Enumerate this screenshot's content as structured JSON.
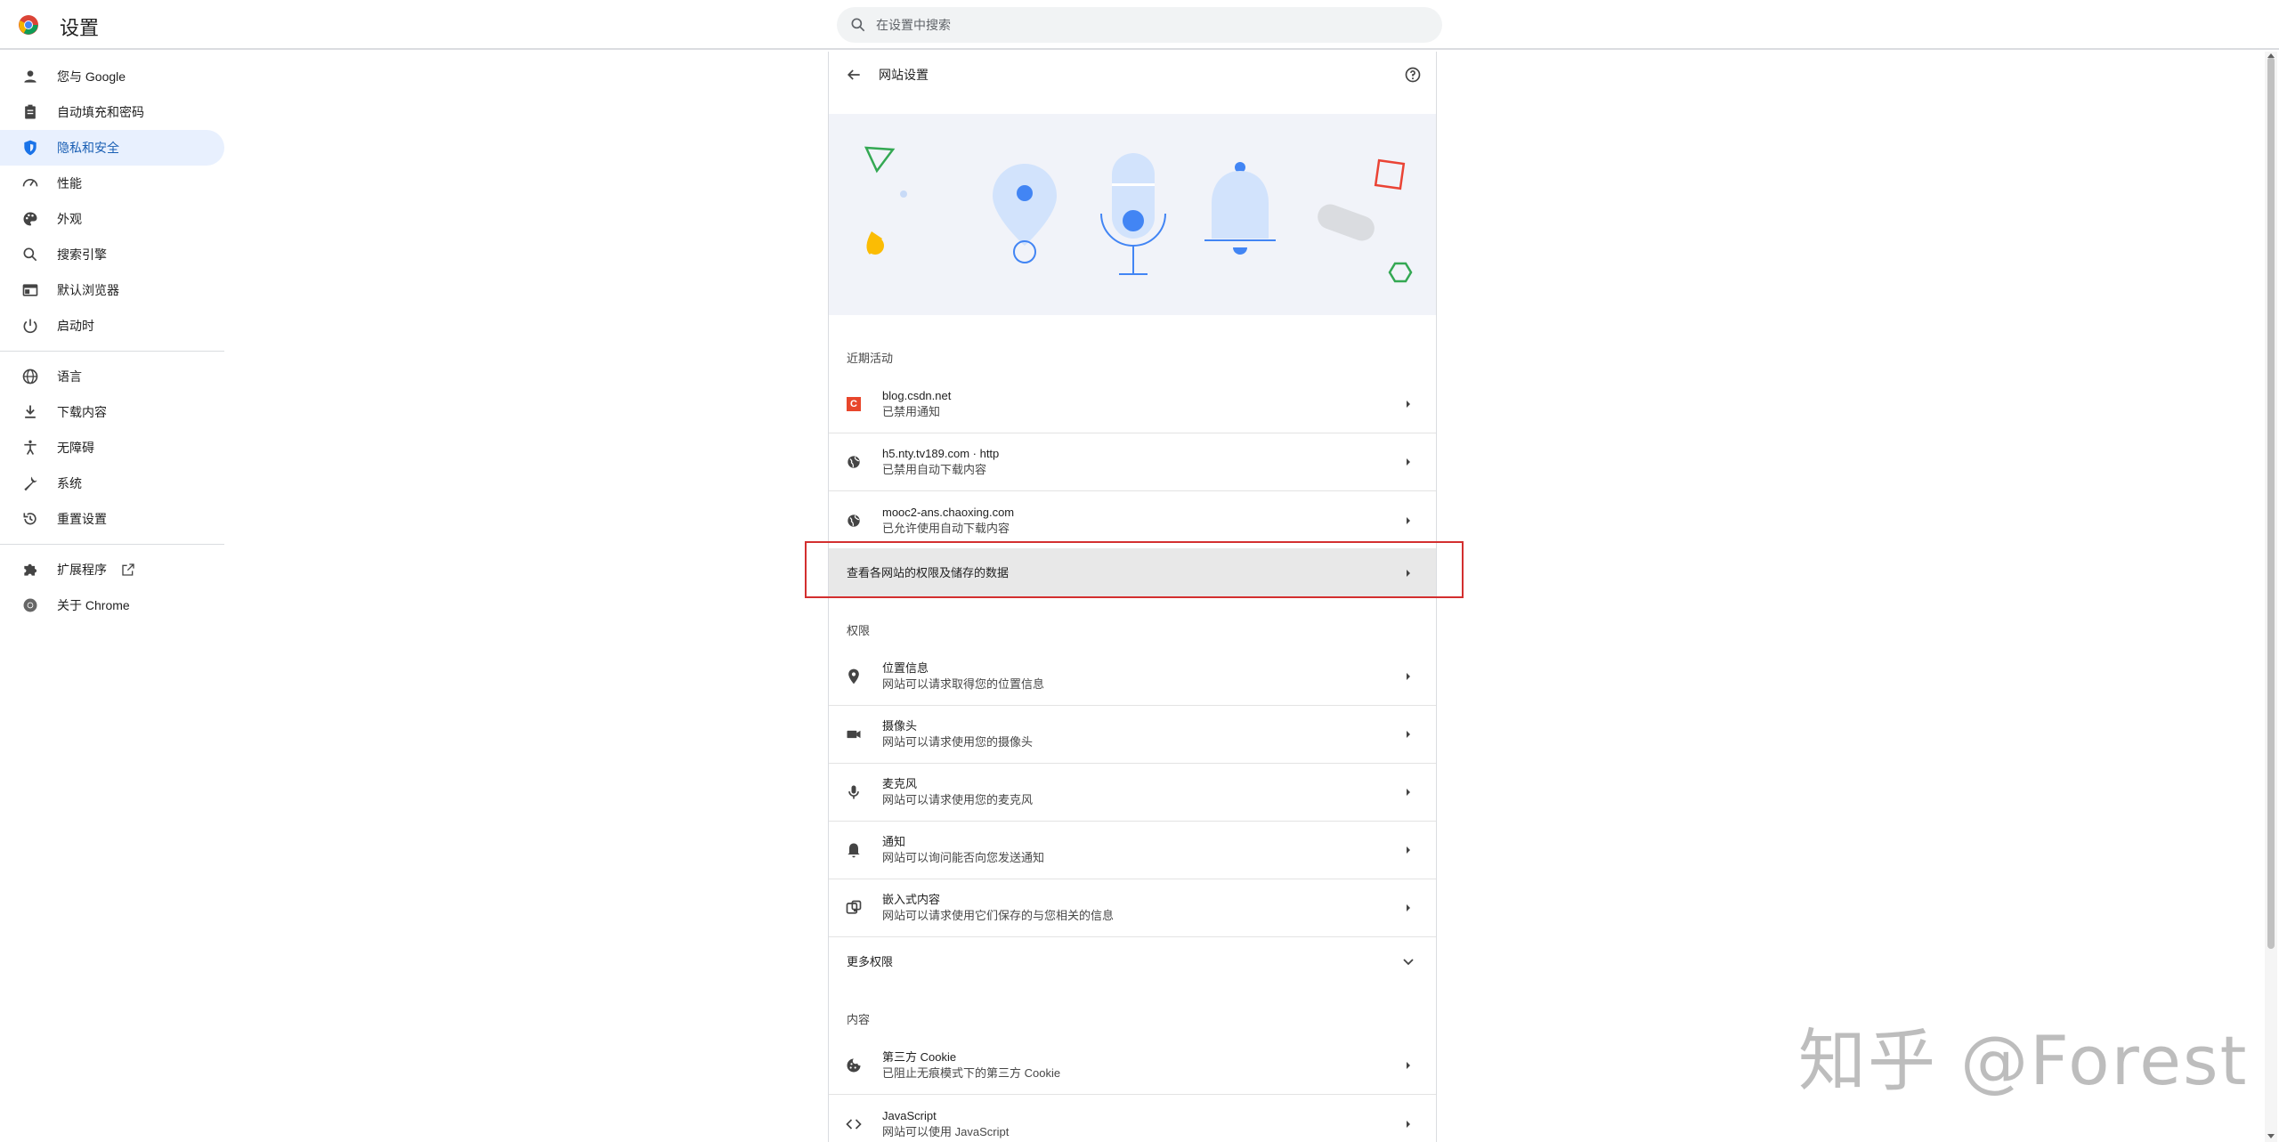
{
  "header": {
    "title": "设置",
    "search_placeholder": "在设置中搜索"
  },
  "sidebar": {
    "groups": [
      [
        {
          "label": "您与 Google",
          "icon": "person-icon"
        },
        {
          "label": "自动填充和密码",
          "icon": "clipboard-icon"
        },
        {
          "label": "隐私和安全",
          "icon": "shield-icon",
          "active": true
        },
        {
          "label": "性能",
          "icon": "gauge-icon"
        },
        {
          "label": "外观",
          "icon": "palette-icon"
        },
        {
          "label": "搜索引擎",
          "icon": "search-icon"
        },
        {
          "label": "默认浏览器",
          "icon": "browser-icon"
        },
        {
          "label": "启动时",
          "icon": "power-icon"
        }
      ],
      [
        {
          "label": "语言",
          "icon": "globe-icon"
        },
        {
          "label": "下载内容",
          "icon": "download-icon"
        },
        {
          "label": "无障碍",
          "icon": "accessibility-icon"
        },
        {
          "label": "系统",
          "icon": "wrench-icon"
        },
        {
          "label": "重置设置",
          "icon": "history-icon"
        }
      ],
      [
        {
          "label": "扩展程序",
          "icon": "puzzle-icon"
        },
        {
          "label": "关于 Chrome",
          "icon": "chrome-icon"
        }
      ]
    ]
  },
  "main": {
    "title": "网站设置",
    "recent_label": "近期活动",
    "recent": [
      {
        "site": "blog.csdn.net",
        "status": "已禁用通知",
        "icon": "csdn-icon"
      },
      {
        "site": "h5.nty.tv189.com · http",
        "status": "已禁用自动下载内容",
        "icon": "globe-icon"
      },
      {
        "site": "mooc2-ans.chaoxing.com",
        "status": "已允许使用自动下载内容",
        "icon": "globe-icon"
      }
    ],
    "view_all_label": "查看各网站的权限及储存的数据",
    "permissions_label": "权限",
    "permissions": [
      {
        "title": "位置信息",
        "desc": "网站可以请求取得您的位置信息",
        "icon": "location-icon"
      },
      {
        "title": "摄像头",
        "desc": "网站可以请求使用您的摄像头",
        "icon": "camera-icon"
      },
      {
        "title": "麦克风",
        "desc": "网站可以请求使用您的麦克风",
        "icon": "mic-icon"
      },
      {
        "title": "通知",
        "desc": "网站可以询问能否向您发送通知",
        "icon": "bell-icon"
      },
      {
        "title": "嵌入式内容",
        "desc": "网站可以请求使用它们保存的与您相关的信息",
        "icon": "embed-icon"
      }
    ],
    "more_permissions_label": "更多权限",
    "content_label": "内容",
    "content": [
      {
        "title": "第三方 Cookie",
        "desc": "已阻止无痕模式下的第三方 Cookie",
        "icon": "cookie-icon"
      },
      {
        "title": "JavaScript",
        "desc": "网站可以使用 JavaScript",
        "icon": "code-icon"
      }
    ]
  },
  "watermark": "知乎 @Forest",
  "colors": {
    "accent": "#1a73e8",
    "active_bg": "#e8f0fe",
    "highlight": "#d32f2f"
  }
}
